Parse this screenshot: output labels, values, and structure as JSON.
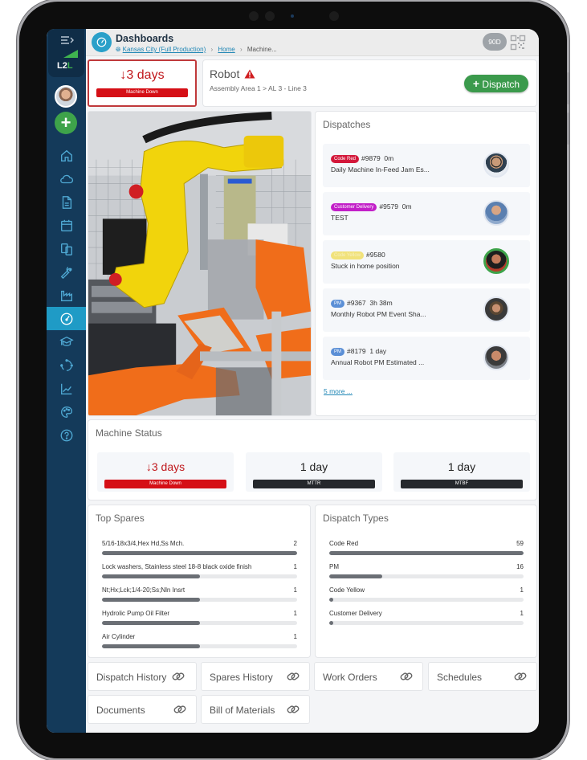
{
  "header": {
    "title": "Dashboards",
    "breadcrumb": [
      {
        "label": "Kansas City (Full Production)",
        "link": true
      },
      {
        "label": "Home",
        "link": true
      },
      {
        "label": "Machine...",
        "link": false
      }
    ],
    "range_badge": "90D"
  },
  "sidebar": {
    "logo_text_a": "L2",
    "logo_text_b": "L",
    "add_label": "+",
    "items": [
      {
        "icon": "home-icon",
        "active": false
      },
      {
        "icon": "cloud-icon",
        "active": false
      },
      {
        "icon": "document-icon",
        "active": false
      },
      {
        "icon": "calendar-icon",
        "active": false
      },
      {
        "icon": "copy-icon",
        "active": false
      },
      {
        "icon": "wrench-icon",
        "active": false
      },
      {
        "icon": "factory-icon",
        "active": false
      },
      {
        "icon": "dashboard-gauge-icon",
        "active": true
      },
      {
        "icon": "graduation-cap-icon",
        "active": false
      },
      {
        "icon": "cycle-icon",
        "active": false
      },
      {
        "icon": "line-chart-icon",
        "active": false
      },
      {
        "icon": "palette-icon",
        "active": false
      },
      {
        "icon": "help-icon",
        "active": false
      }
    ]
  },
  "status_card": {
    "arrow": "↓",
    "value": "3 days",
    "label": "Machine Down"
  },
  "machine": {
    "name": "Robot",
    "path": "Assembly Area 1  >  AL 3 - Line 3",
    "dispatch_button": "Dispatch"
  },
  "dispatches": {
    "title": "Dispatches",
    "items": [
      {
        "tag": "Code Red",
        "tag_color": "#d3173a",
        "tag_text_color": "#ffffff",
        "number": "#9879",
        "age": "0m",
        "description": "Daily Machine In-Feed Jam Es..."
      },
      {
        "tag": "Customer Delivery",
        "tag_color": "#c21fc8",
        "tag_text_color": "#ffffff",
        "number": "#9579",
        "age": "0m",
        "description": "TEST"
      },
      {
        "tag": "Code Yellow",
        "tag_color": "#f1e27a",
        "tag_text_color": "#f7f0c0",
        "number": "#9580",
        "age": "",
        "description": "Stuck in home position"
      },
      {
        "tag": "PM",
        "tag_color": "#5b8fd6",
        "tag_text_color": "#ffffff",
        "number": "#9367",
        "age": "3h 38m",
        "description": "Monthly Robot PM Event Sha..."
      },
      {
        "tag": "PM",
        "tag_color": "#5b8fd6",
        "tag_text_color": "#ffffff",
        "number": "#8179",
        "age": "1 day",
        "description": "Annual Robot PM Estimated ..."
      }
    ],
    "more_link": "5 more ..."
  },
  "machine_status": {
    "title": "Machine Status",
    "boxes": [
      {
        "arrow": "↓",
        "value": "3 days",
        "label": "Machine Down",
        "style": "red"
      },
      {
        "arrow": "",
        "value": "1 day",
        "label": "MTTR",
        "style": "dark"
      },
      {
        "arrow": "",
        "value": "1 day",
        "label": "MTBF",
        "style": "dark"
      }
    ]
  },
  "top_spares": {
    "title": "Top Spares",
    "max": 2,
    "items": [
      {
        "label": "5/16-18x3/4,Hex Hd,Ss Mch.",
        "value": 2
      },
      {
        "label": "Lock washers, Stainless steel 18-8 black oxide finish",
        "value": 1
      },
      {
        "label": "Nt;Hx;Lck;1/4-20;Ss;Nln Insrt",
        "value": 1
      },
      {
        "label": "Hydrolic Pump Oil Filter",
        "value": 1
      },
      {
        "label": "Air Cylinder",
        "value": 1
      }
    ]
  },
  "dispatch_types": {
    "title": "Dispatch Types",
    "max": 59,
    "items": [
      {
        "label": "Code Red",
        "value": 59
      },
      {
        "label": "PM",
        "value": 16
      },
      {
        "label": "Code Yellow",
        "value": 1
      },
      {
        "label": "Customer Delivery",
        "value": 1
      }
    ]
  },
  "links": [
    {
      "label": "Dispatch History"
    },
    {
      "label": "Spares History"
    },
    {
      "label": "Work Orders"
    },
    {
      "label": "Schedules"
    },
    {
      "label": "Documents"
    },
    {
      "label": "Bill of Materials"
    }
  ],
  "colors": {
    "sidebar": "#143a5a",
    "accent": "#1f9bc6",
    "danger": "#d50f16",
    "success": "#3b9a4c"
  }
}
